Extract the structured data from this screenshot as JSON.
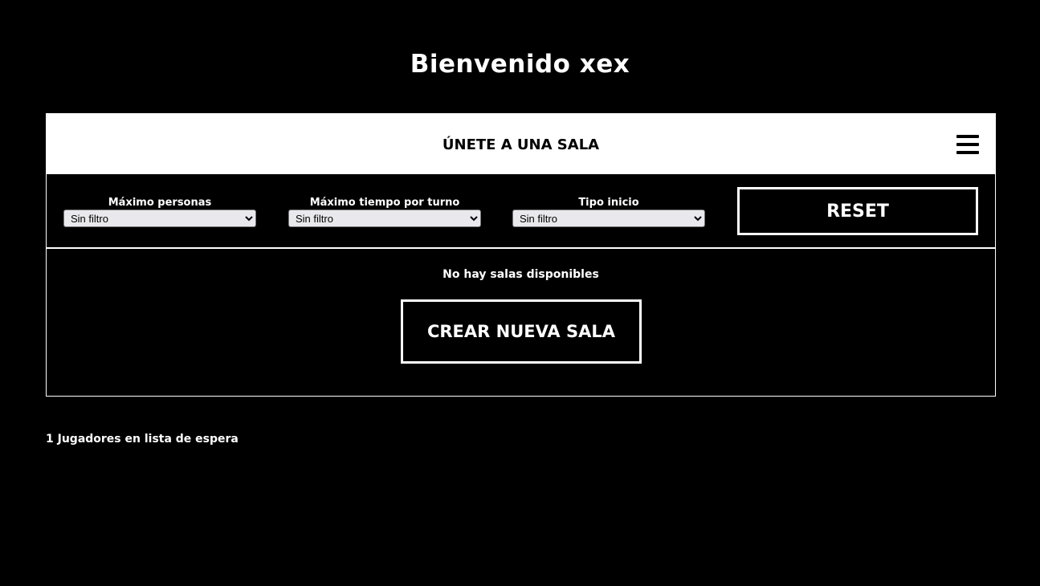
{
  "header": {
    "welcome_text": "Bienvenido xex"
  },
  "join_panel": {
    "title": "ÚNETE A UNA SALA",
    "menu_icon": "hamburger-menu-icon",
    "filters": {
      "max_people": {
        "label": "Máximo personas",
        "selected": "Sin filtro"
      },
      "max_turn_time": {
        "label": "Máximo tiempo por turno",
        "selected": "Sin filtro"
      },
      "start_type": {
        "label": "Tipo inicio",
        "selected": "Sin filtro"
      },
      "reset_label": "RESET"
    },
    "rooms": {
      "empty_message": "No hay salas disponibles",
      "create_label": "CREAR NUEVA SALA"
    }
  },
  "footer": {
    "waiting_text": "1 Jugadores en lista de espera"
  },
  "colors": {
    "background": "#000000",
    "foreground": "#ffffff",
    "select_background": "#e9e9ed"
  }
}
